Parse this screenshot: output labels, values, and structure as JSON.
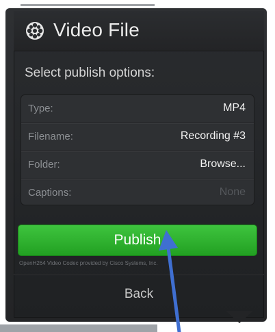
{
  "dialog": {
    "title": "Video File",
    "title_icon": "film-reel-icon",
    "section_label": "Select publish options:",
    "options": [
      {
        "label": "Type:",
        "value": "MP4",
        "enabled": true
      },
      {
        "label": "Filename:",
        "value": "Recording #3",
        "enabled": true
      },
      {
        "label": "Folder:",
        "value": "Browse...",
        "enabled": true
      },
      {
        "label": "Captions:",
        "value": "None",
        "enabled": false
      }
    ],
    "publish_label": "Publish",
    "codec_note": "OpenH264 Video Codec provided by Cisco Systems, Inc.",
    "back_label": "Back"
  },
  "annotation": {
    "arrow_icon": "arrow-pointing-up-icon",
    "arrow_color": "#3f6fd1"
  },
  "colors": {
    "publish_green": "#2fb52f",
    "panel_bg": "#26282a"
  }
}
